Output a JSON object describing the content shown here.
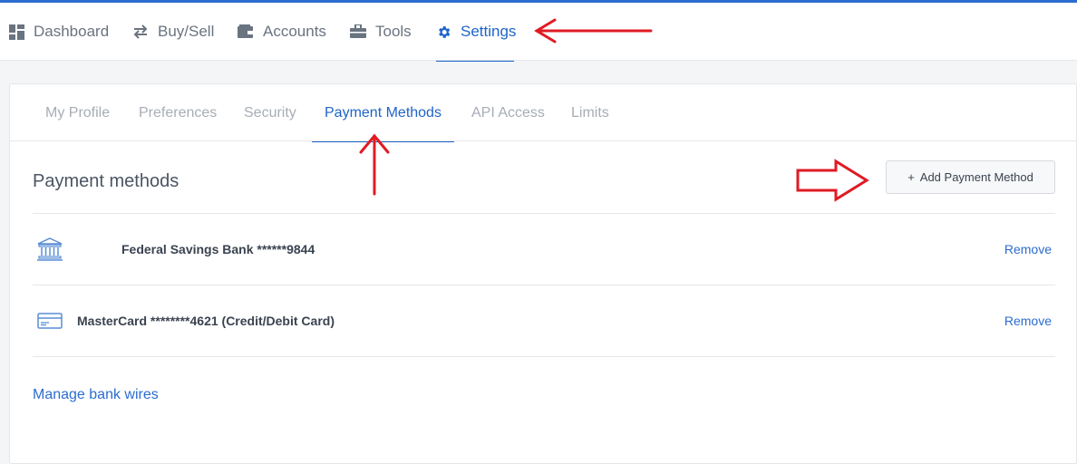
{
  "topnav": {
    "items": [
      {
        "label": "Dashboard",
        "icon": "dashboard-icon"
      },
      {
        "label": "Buy/Sell",
        "icon": "swap-arrows-icon"
      },
      {
        "label": "Accounts",
        "icon": "wallet-icon"
      },
      {
        "label": "Tools",
        "icon": "briefcase-icon"
      },
      {
        "label": "Settings",
        "icon": "gear-icon",
        "active": true
      }
    ]
  },
  "settings": {
    "tabs": [
      {
        "label": "My Profile"
      },
      {
        "label": "Preferences"
      },
      {
        "label": "Security"
      },
      {
        "label": "Payment Methods",
        "active": true
      },
      {
        "label": "API Access"
      },
      {
        "label": "Limits"
      }
    ],
    "section_title": "Payment methods",
    "add_button": {
      "plus": "+",
      "label": "Add Payment Method"
    },
    "methods": [
      {
        "label": "Federal Savings Bank ******9844",
        "icon": "bank-icon",
        "action": "Remove"
      },
      {
        "label": "MasterCard ********4621 (Credit/Debit Card)",
        "icon": "credit-card-icon",
        "action": "Remove"
      }
    ],
    "manage_link": "Manage bank wires"
  },
  "colors": {
    "accent": "#1f64c8",
    "link": "#2c6ccf",
    "annotation": "#e01b24"
  }
}
